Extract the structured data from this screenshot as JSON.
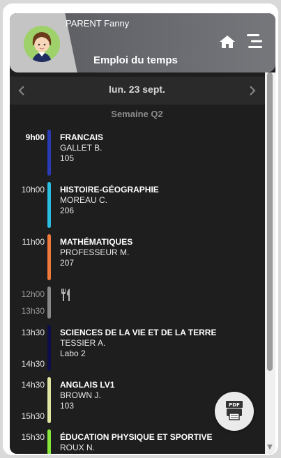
{
  "header": {
    "parent_name": "PARENT Fanny",
    "title": "Emploi du temps",
    "home_icon": "home-icon",
    "menu_icon": "menu-icon"
  },
  "date_nav": {
    "date": "lun. 23 sept.",
    "week": "Semaine Q2"
  },
  "schedule": [
    {
      "start": "9h00",
      "end": "",
      "subject": "FRANCAIS",
      "teacher": "GALLET B.",
      "room": "105",
      "color": "#2b3ab5"
    },
    {
      "start": "10h00",
      "end": "",
      "subject": "HISTOIRE-GÉOGRAPHIE",
      "teacher": "MOREAU C.",
      "room": "206",
      "color": "#2bbde0"
    },
    {
      "start": "11h00",
      "end": "",
      "subject": "MATHÉMATIQUES",
      "teacher": "PROFESSEUR M.",
      "room": "207",
      "color": "#f07a3c"
    },
    {
      "start": "12h00",
      "end": "13h30",
      "subject": "",
      "teacher": "",
      "room": "",
      "color": "#8a8a8a",
      "icon": "fork-knife-icon"
    },
    {
      "start": "13h30",
      "end": "14h30",
      "subject": "SCIENCES DE LA VIE ET DE LA TERRE",
      "teacher": "TESSIER A.",
      "room": "Labo 2",
      "color": "#0d0d4a"
    },
    {
      "start": "14h30",
      "end": "15h30",
      "subject": "ANGLAIS LV1",
      "teacher": "BROWN J.",
      "room": "103",
      "color": "#e2e6a3"
    },
    {
      "start": "15h30",
      "end": "",
      "subject": "ÉDUCATION PHYSIQUE ET SPORTIVE",
      "teacher": "ROUX N.",
      "room": "",
      "color": "#86e63a"
    }
  ],
  "pdf_button": {
    "label": "PDF",
    "icon": "print-icon"
  }
}
